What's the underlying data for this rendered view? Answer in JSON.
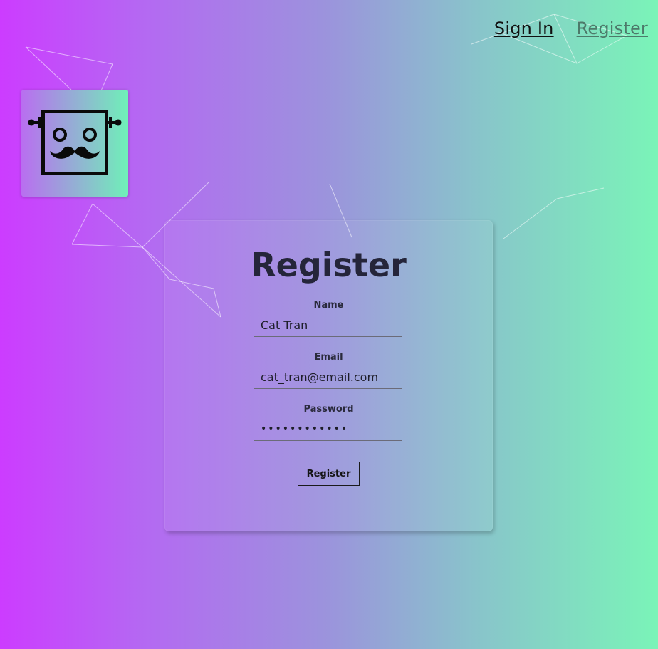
{
  "nav": {
    "sign_in_label": "Sign In",
    "register_label": "Register"
  },
  "logo": {
    "icon": "robot-mustache-icon"
  },
  "form": {
    "title": "Register",
    "name_label": "Name",
    "name_value": "Cat Tran",
    "email_label": "Email",
    "email_value": "cat_tran@email.com",
    "password_label": "Password",
    "password_value": "••••••••••••",
    "submit_label": "Register"
  },
  "colors": {
    "gradient_start": "#cc3cff",
    "gradient_end": "#7af4b8",
    "title_text": "#25253a",
    "active_nav_link": "#111111",
    "inactive_nav_link": "#4d7a6a"
  }
}
